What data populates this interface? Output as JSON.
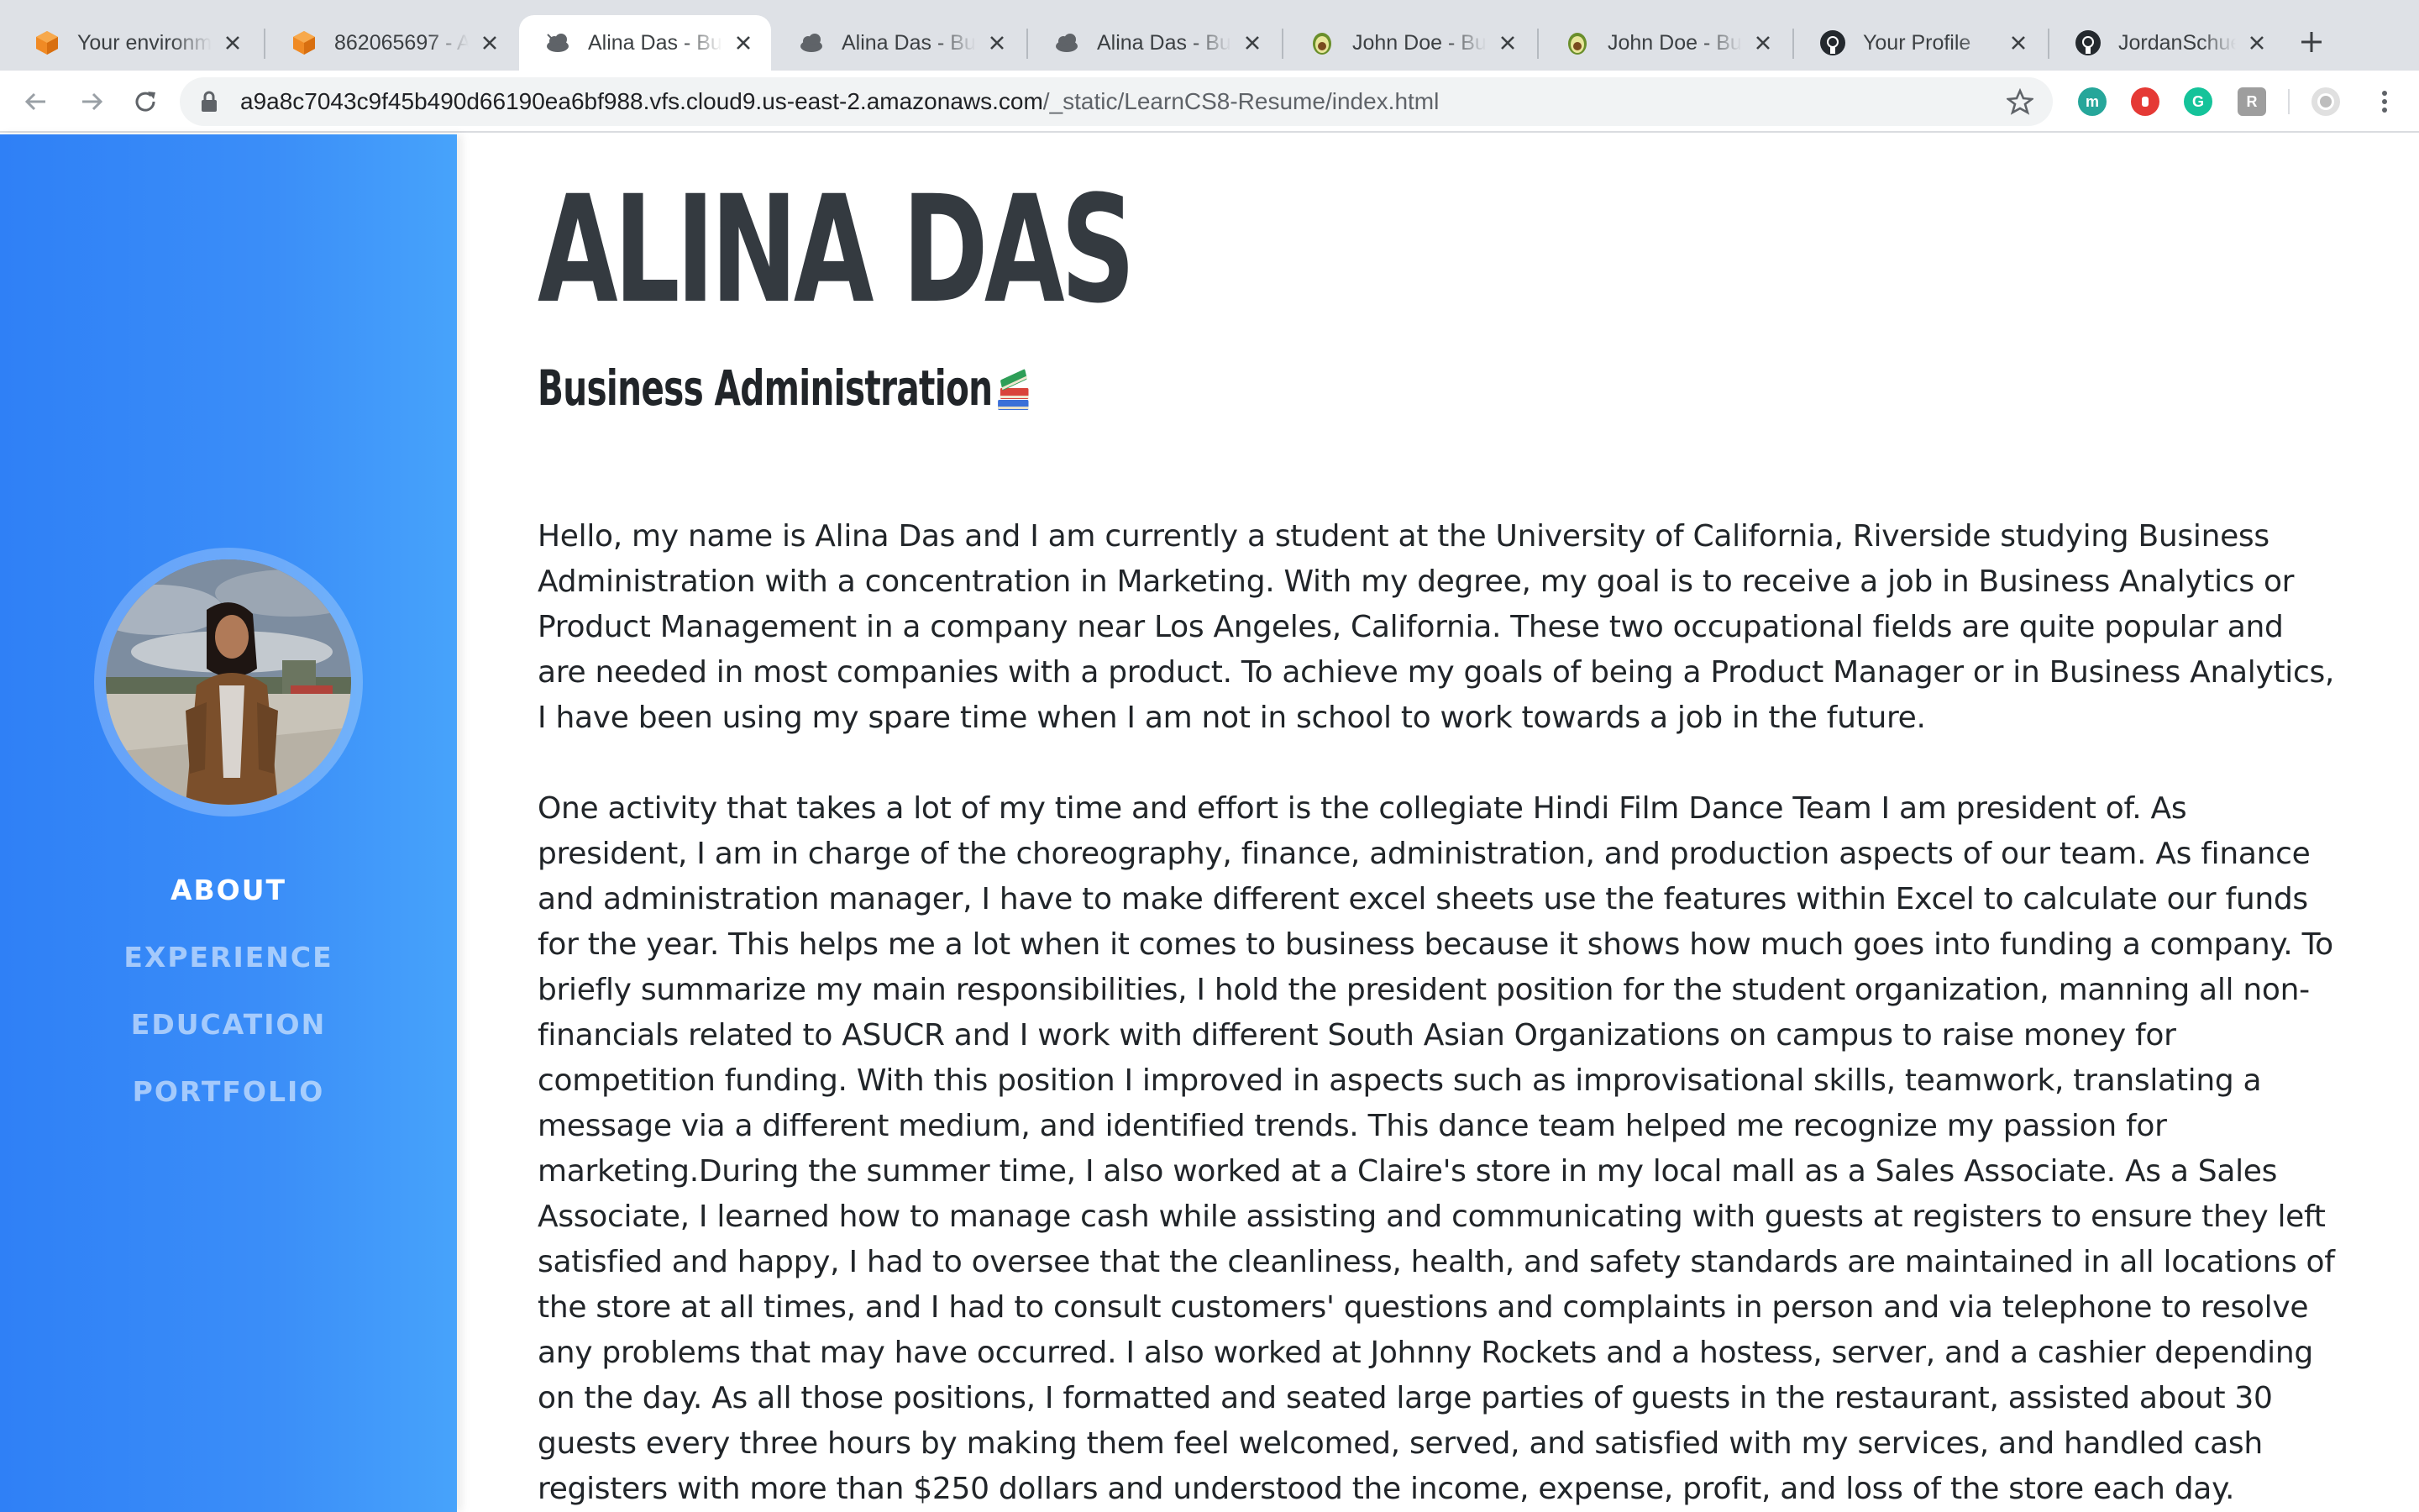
{
  "browser": {
    "tabs": [
      {
        "title": "Your environme",
        "icon": "aws-cube-icon"
      },
      {
        "title": "862065697 - A",
        "icon": "aws-cube-icon"
      },
      {
        "title": "Alina Das - Bus",
        "icon": "cloud9-icon"
      },
      {
        "title": "Alina Das - Bus",
        "icon": "cloud9-icon"
      },
      {
        "title": "Alina Das - Bus",
        "icon": "cloud9-icon"
      },
      {
        "title": "John Doe - Bus",
        "icon": "avocado-icon"
      },
      {
        "title": "John Doe - Bus",
        "icon": "avocado-icon"
      },
      {
        "title": "Your Profile",
        "icon": "github-icon"
      },
      {
        "title": "JordanSchuetz",
        "icon": "github-icon"
      }
    ],
    "active_tab_index": 2,
    "url_host": "a9a8c7043c9f45b490d66190ea6bf988.vfs.cloud9.us-east-2.amazonaws.com",
    "url_path": "/_static/LearnCS8-Resume/index.html",
    "extension_colors": [
      "#26a69a",
      "#e53935",
      "#15c39a",
      "#9e9e9e"
    ]
  },
  "sidebar": {
    "nav": [
      {
        "label": "ABOUT",
        "active": true
      },
      {
        "label": "EXPERIENCE",
        "active": false
      },
      {
        "label": "EDUCATION",
        "active": false
      },
      {
        "label": "PORTFOLIO",
        "active": false
      }
    ],
    "gradient": [
      "#2f80f6",
      "#47a3fb"
    ]
  },
  "main": {
    "name": "ALINA DAS",
    "subtitle": "Business Administration",
    "paragraphs": [
      "Hello, my name is Alina Das and I am currently a student at the University of California, Riverside studying Business Administration with a concentration in Marketing. With my degree, my goal is to receive a job in Business Analytics or Product Management in a company near Los Angeles, California. These two occupational fields are quite popular and are needed in most companies with a product. To achieve my goals of being a Product Manager or in Business Analytics, I have been using my spare time when I am not in school to work towards a job in the future.",
      "One activity that takes a lot of my time and effort is the collegiate Hindi Film Dance Team I am president of. As president, I am in charge of the choreography, finance, administration, and production aspects of our team. As finance and administration manager, I have to make different excel sheets use the features within Excel to calculate our funds for the year. This helps me a lot when it comes to business because it shows how much goes into funding a company. To briefly summarize my main responsibilities, I hold the president position for the student organization, manning all non-financials related to ASUCR and I work with different South Asian Organizations on campus to raise money for competition funding. With this position I improved in aspects such as improvisational skills, teamwork, translating a message via a different medium, and identified trends. This dance team helped me recognize my passion for marketing.During the summer time, I also worked at a Claire's store in my local mall as a Sales Associate. As a Sales Associate, I learned how to manage cash while assisting and communicating with guests at registers to ensure they left satisfied and happy, I had to oversee that the cleanliness, health, and safety standards are maintained in all locations of the store at all times, and I had to consult customers' questions and complaints in person and via telephone to resolve any problems that may have occurred. I also worked at Johnny Rockets and a hostess, server, and a cashier depending on the day. As all those positions, I formatted and seated large parties of guests in the restaurant, assisted about 30 guests every three hours by making them feel welcomed, served, and satisfied with my services, and handled cash registers with more than $250 dollars and understood the income, expense, profit, and loss of the store each day."
    ]
  }
}
